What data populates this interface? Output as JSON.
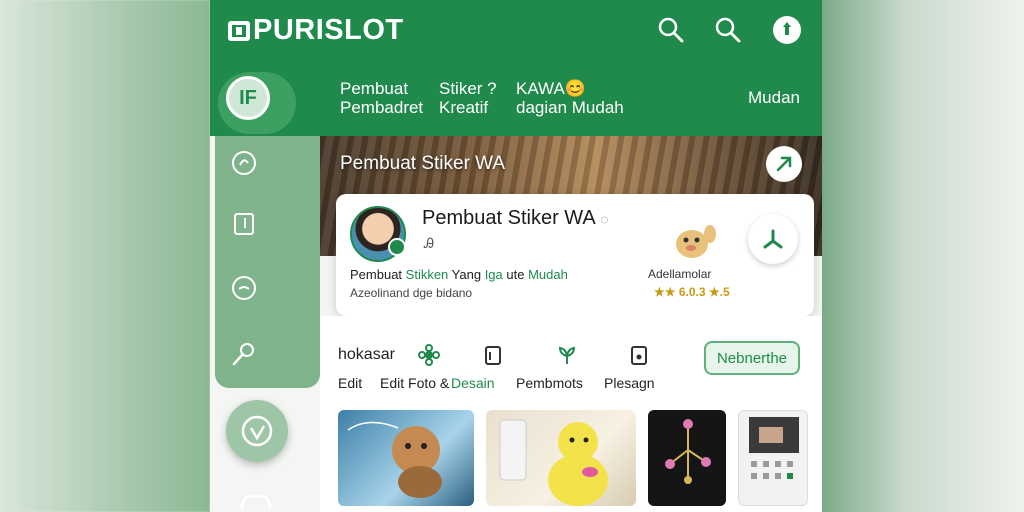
{
  "app": {
    "logo_text": "PURISLOT"
  },
  "nav": {
    "items": [
      {
        "label": "Pembuat\nPembadret"
      },
      {
        "label": "Stiker ?\nKreatif"
      },
      {
        "label": "KAWA😊\ndagian Mudah"
      },
      {
        "label": "Mudan"
      }
    ],
    "avatar_text": "IF"
  },
  "banner": {
    "title": "Pembuat Stiker WA"
  },
  "card": {
    "title": "Pembuat Stiker WA",
    "title_suffix": "◌",
    "sub_icon": "Ꭿ",
    "desc_line1_a": "Pembuat ",
    "desc_line1_b": "Stikken",
    "desc_line1_c": " Yang ",
    "desc_line1_d": "Iga",
    "desc_line1_e": " ute ",
    "desc_line1_f": "Mudah",
    "desc_line2": "Azeolinand dge bidano",
    "mascot_name": "Adellamolar",
    "rating": "★★ 6.0.3 ★.5"
  },
  "tools": {
    "heading": "hokasar",
    "captions": [
      "Edit",
      "Edit Foto &",
      "Desain",
      "Pembmots",
      "Plesagn"
    ],
    "next_label": "Nebnerthe"
  },
  "colors": {
    "brand_green": "#1f8a4c",
    "sidebar_green": "#7fb38c",
    "rating_gold": "#c79b14"
  },
  "icons": [
    "search-icon",
    "search-icon",
    "notification-icon",
    "sparkle-icon",
    "book-icon",
    "clock-icon",
    "key-icon",
    "like-icon",
    "arrow-icon",
    "share-icon"
  ]
}
